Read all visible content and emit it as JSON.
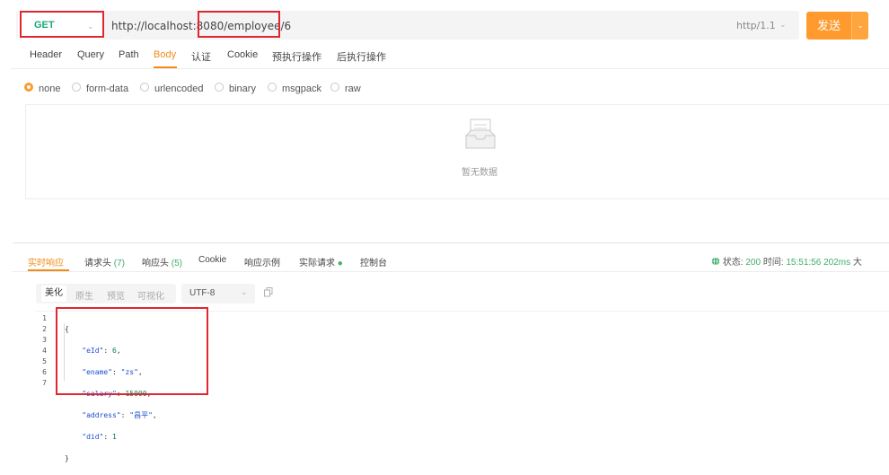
{
  "request": {
    "method": "GET",
    "url": "http://localhost:8080/employee/6",
    "http_version": "http/1.1",
    "send_label": "发送"
  },
  "req_tabs": [
    "Header",
    "Query",
    "Path",
    "Body",
    "认证",
    "Cookie",
    "预执行操作",
    "后执行操作"
  ],
  "body_modes": [
    "none",
    "form-data",
    "urlencoded",
    "binary",
    "msgpack",
    "raw"
  ],
  "empty_text": "暂无数据",
  "response": {
    "tabs": {
      "realtime": "实时响应",
      "req_headers": "请求头",
      "req_headers_count": "(7)",
      "resp_headers": "响应头",
      "resp_headers_count": "(5)",
      "cookie": "Cookie",
      "example": "响应示例",
      "actual": "实际请求",
      "console": "控制台"
    },
    "status_label": "状态:",
    "status_code": "200",
    "time_label": "时间:",
    "time_value": "15:51:56",
    "duration": "202ms",
    "size_label": "大",
    "format_buttons": [
      "美化",
      "原生",
      "预览",
      "可视化"
    ],
    "encoding": "UTF-8",
    "line_numbers": [
      "1",
      "2",
      "3",
      "4",
      "5",
      "6",
      "7"
    ],
    "json": {
      "open": "{",
      "eId_key": "\"eId\"",
      "eId_val": "6",
      "ename_key": "\"ename\"",
      "ename_val": "\"zs\"",
      "salary_key": "\"salary\"",
      "salary_val": "15000",
      "address_key": "\"address\"",
      "address_val": "\"昌平\"",
      "did_key": "\"did\"",
      "did_val": "1",
      "close": "}"
    }
  },
  "colors": {
    "accent": "#ff9a2e",
    "highlight_box": "#e0262e",
    "method": "#19a974",
    "status_ok": "#3fae6a"
  },
  "icons": [
    "chevron-down-icon",
    "globe-icon",
    "copy-icon",
    "empty-inbox-icon",
    "dot-icon"
  ]
}
